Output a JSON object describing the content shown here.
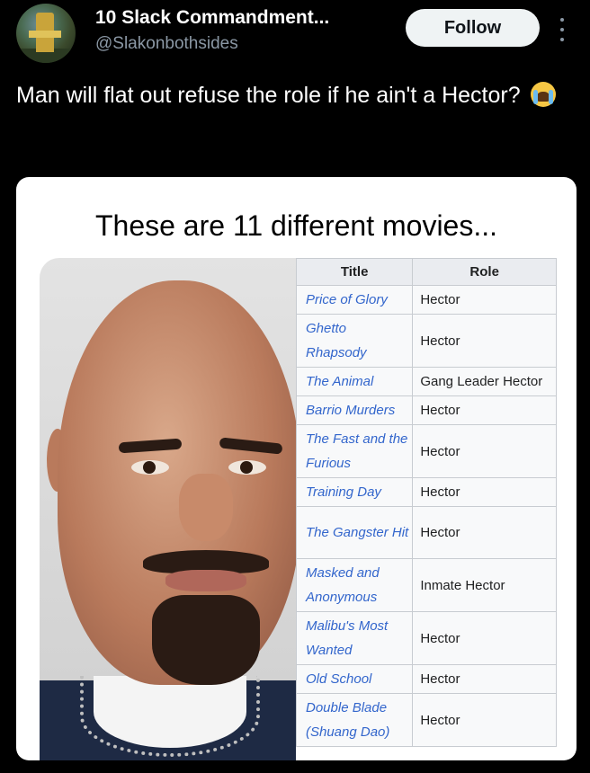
{
  "header": {
    "display_name": "10 Slack Commandment...",
    "handle": "@Slakonbothsides",
    "follow_label": "Follow"
  },
  "tweet": {
    "text": "Man will flat out refuse the role if he ain't a Hector?",
    "emoji": "loudly-crying-face"
  },
  "card": {
    "title": "These are 11 different movies...",
    "table": {
      "headers": [
        "Title",
        "Role"
      ],
      "rows": [
        {
          "title": "Price of Glory",
          "role": "Hector"
        },
        {
          "title": "Ghetto Rhapsody",
          "role": "Hector"
        },
        {
          "title": "The Animal",
          "role": "Gang Leader Hector"
        },
        {
          "title": "Barrio Murders",
          "role": "Hector"
        },
        {
          "title": "The Fast and the Furious",
          "role": "Hector"
        },
        {
          "title": "Training Day",
          "role": "Hector"
        },
        {
          "title": "The Gangster Hit",
          "role": "Hector"
        },
        {
          "title": "Masked and Anonymous",
          "role": "Inmate Hector"
        },
        {
          "title": "Malibu's Most Wanted",
          "role": "Hector"
        },
        {
          "title": "Old School",
          "role": "Hector"
        },
        {
          "title": "Double Blade (Shuang Dao)",
          "role": "Hector"
        }
      ]
    }
  },
  "colors": {
    "background": "#000000",
    "link": "#3366cc",
    "handle": "#8b98a5"
  }
}
